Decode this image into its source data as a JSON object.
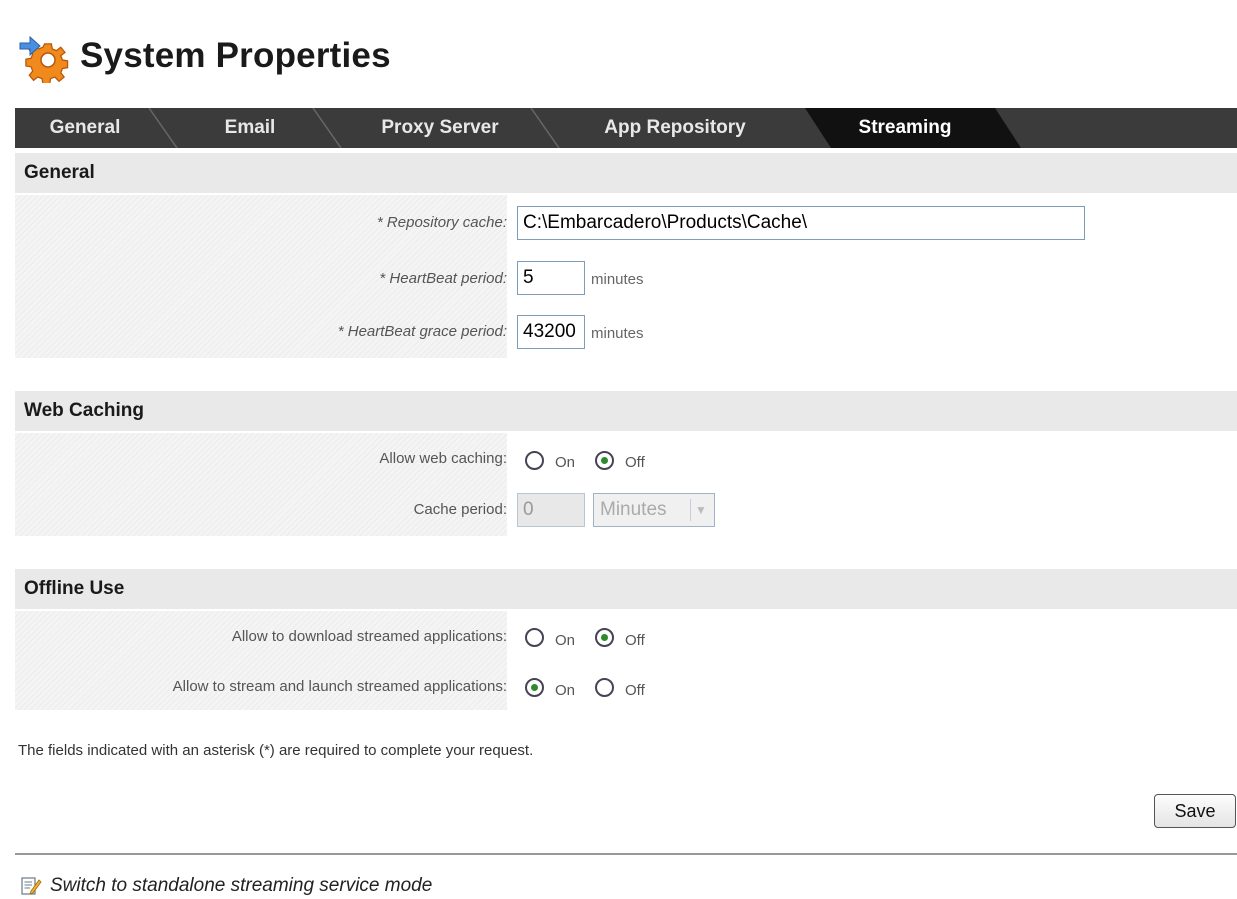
{
  "page": {
    "title": "System Properties"
  },
  "tabs": [
    {
      "label": "General"
    },
    {
      "label": "Email"
    },
    {
      "label": "Proxy Server"
    },
    {
      "label": "App Repository"
    },
    {
      "label": "Streaming",
      "active": true
    }
  ],
  "general": {
    "header": "General",
    "repository_cache": {
      "label": "* Repository cache:",
      "value": "C:\\Embarcadero\\Products\\Cache\\"
    },
    "heartbeat_period": {
      "label": "* HeartBeat period:",
      "value": "5",
      "unit": "minutes"
    },
    "heartbeat_grace": {
      "label": "* HeartBeat grace period:",
      "value": "43200",
      "unit": "minutes"
    }
  },
  "web_caching": {
    "header": "Web Caching",
    "allow": {
      "label": "Allow web caching:",
      "on": "On",
      "off": "Off",
      "selected": "off"
    },
    "cache_period": {
      "label": "Cache period:",
      "value": "0",
      "unit_selected": "Minutes"
    }
  },
  "offline": {
    "header": "Offline Use",
    "download": {
      "label": "Allow to download streamed applications:",
      "on": "On",
      "off": "Off",
      "selected": "off"
    },
    "stream_launch": {
      "label": "Allow to stream and launch streamed applications:",
      "on": "On",
      "off": "Off",
      "selected": "on"
    }
  },
  "note": "The fields indicated with an asterisk (*) are required to complete your request.",
  "save_label": "Save",
  "footer_link": "Switch to standalone streaming service mode",
  "colors": {
    "tabbar": "#3b3b3b",
    "active_tab": "#111111",
    "radio_checked": "#2d8a2d"
  },
  "icons": {
    "title": "gear-arrow-icon",
    "footer": "document-edit-icon"
  }
}
